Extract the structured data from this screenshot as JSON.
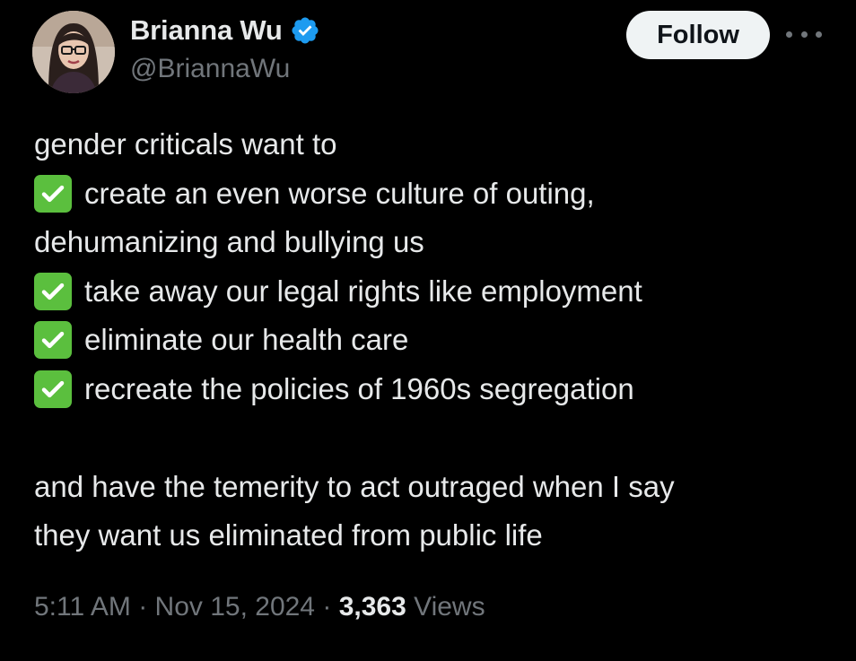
{
  "author": {
    "display_name": "Brianna Wu",
    "handle": "@BriannaWu",
    "verified_icon": "verified-badge-icon",
    "verified_color": "#1d9bf0"
  },
  "actions": {
    "follow_label": "Follow",
    "more_icon": "more-options-icon"
  },
  "tweet": {
    "intro": "gender criticals want to",
    "items": [
      {
        "icon": "check-mark-button-emoji",
        "lines": [
          "create an even worse culture of outing,",
          "dehumanizing and bullying us"
        ]
      },
      {
        "icon": "check-mark-button-emoji",
        "lines": [
          "take away our legal rights like employment"
        ]
      },
      {
        "icon": "check-mark-button-emoji",
        "lines": [
          "eliminate our health care"
        ]
      },
      {
        "icon": "check-mark-button-emoji",
        "lines": [
          "recreate the policies of 1960s segregation"
        ]
      }
    ],
    "closing": [
      "and have the temerity to act outraged when I say",
      "they want us eliminated from public life"
    ]
  },
  "meta": {
    "time": "5:11 AM",
    "separator": "·",
    "date": "Nov 15, 2024",
    "views_count": "3,363",
    "views_label": "Views"
  },
  "colors": {
    "background": "#000000",
    "text_primary": "#e7e9ea",
    "text_secondary": "#71767b",
    "follow_bg": "#eff3f4",
    "check_green": "#5bbf3e"
  }
}
